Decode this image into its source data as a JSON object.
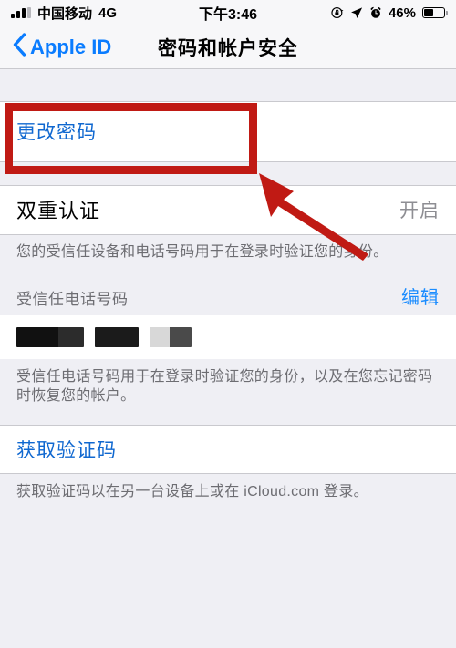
{
  "status_bar": {
    "carrier": "中国移动",
    "network": "4G",
    "time": "下午3:46",
    "battery_percent": "46%",
    "icons": [
      "signal-bars-icon",
      "rotation-lock-icon",
      "location-arrow-icon",
      "alarm-clock-icon",
      "battery-icon"
    ]
  },
  "nav": {
    "back_label": "Apple ID",
    "back_icon": "chevron-left-icon",
    "title": "密码和帐户安全"
  },
  "sections": {
    "change_password": {
      "label": "更改密码"
    },
    "two_factor": {
      "title": "双重认证",
      "value": "开启",
      "footer": "您的受信任设备和电话号码用于在登录时验证您的身份。"
    },
    "trusted_numbers": {
      "header": "受信任电话号码",
      "action": "编辑",
      "redacted_note": "phone-number-redacted",
      "footer": "受信任电话号码用于在登录时验证您的身份，以及在您忘记密码时恢复您的帐户。"
    },
    "verification_code": {
      "label": "获取验证码",
      "footer": "获取验证码以在另一台设备上或在 iCloud.com 登录。"
    }
  },
  "annotations": {
    "highlight_color": "#c01a14",
    "highlight_target": "更改密码",
    "arrow": "red-arrow-pointing-to-change-password"
  },
  "colors": {
    "link_blue": "#1068d0",
    "tint_blue": "#0a7cff",
    "background_gray": "#efeff4",
    "cell_white": "#ffffff",
    "secondary_text": "#6d6d72",
    "annotation_red": "#c01a14"
  }
}
